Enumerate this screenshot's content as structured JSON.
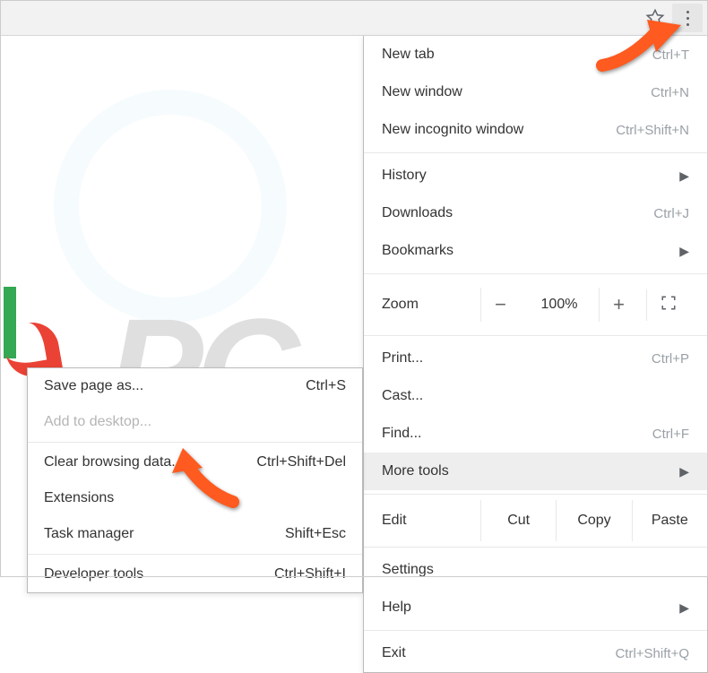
{
  "toolbar": {
    "star_title": "Bookmark this page",
    "menu_title": "Customize and control Google Chrome"
  },
  "menu": {
    "new_tab": {
      "label": "New tab",
      "shortcut": "Ctrl+T"
    },
    "new_window": {
      "label": "New window",
      "shortcut": "Ctrl+N"
    },
    "new_incognito": {
      "label": "New incognito window",
      "shortcut": "Ctrl+Shift+N"
    },
    "history": {
      "label": "History"
    },
    "downloads": {
      "label": "Downloads",
      "shortcut": "Ctrl+J"
    },
    "bookmarks": {
      "label": "Bookmarks"
    },
    "zoom": {
      "label": "Zoom",
      "minus": "−",
      "pct": "100%",
      "plus": "+"
    },
    "print": {
      "label": "Print...",
      "shortcut": "Ctrl+P"
    },
    "cast": {
      "label": "Cast..."
    },
    "find": {
      "label": "Find...",
      "shortcut": "Ctrl+F"
    },
    "more_tools": {
      "label": "More tools"
    },
    "edit": {
      "label": "Edit",
      "cut": "Cut",
      "copy": "Copy",
      "paste": "Paste"
    },
    "settings": {
      "label": "Settings"
    },
    "help": {
      "label": "Help"
    },
    "exit": {
      "label": "Exit",
      "shortcut": "Ctrl+Shift+Q"
    }
  },
  "submenu": {
    "save_page": {
      "label": "Save page as...",
      "shortcut": "Ctrl+S"
    },
    "add_desktop": {
      "label": "Add to desktop..."
    },
    "clear_browsing": {
      "label": "Clear browsing data...",
      "shortcut": "Ctrl+Shift+Del"
    },
    "extensions": {
      "label": "Extensions"
    },
    "task_manager": {
      "label": "Task manager",
      "shortcut": "Shift+Esc"
    },
    "developer_tools": {
      "label": "Developer tools",
      "shortcut": "Ctrl+Shift+I"
    }
  },
  "watermark": {
    "text": "PC .com"
  },
  "annotations": {
    "color": "#ff5a1f"
  }
}
